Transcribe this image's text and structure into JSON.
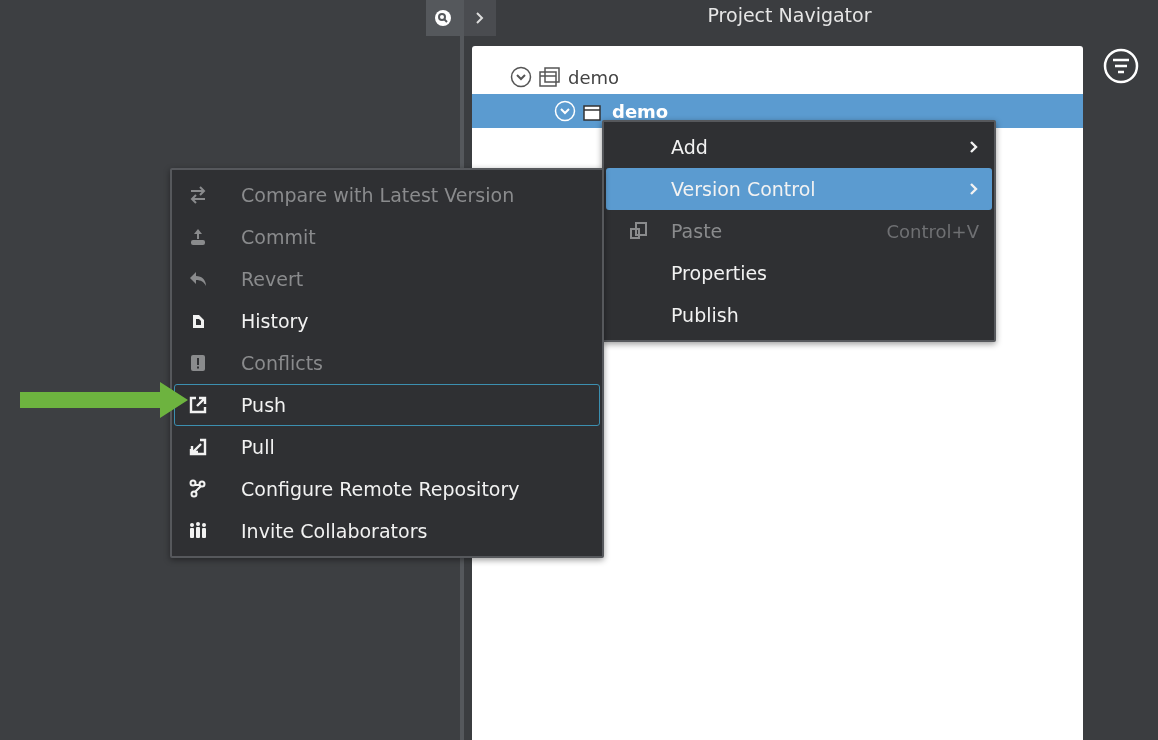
{
  "header": {
    "title": "Project Navigator"
  },
  "tree": [
    {
      "label": "demo",
      "expanded": true,
      "selected": false,
      "children": [
        {
          "label": "demo",
          "expanded": true,
          "selected": true
        }
      ]
    }
  ],
  "context_menu": [
    {
      "label": "Add",
      "kind": "submenu",
      "disabled": false,
      "selected": false
    },
    {
      "label": "Version Control",
      "kind": "submenu",
      "disabled": false,
      "selected": true
    },
    {
      "label": "Paste",
      "kind": "shortcut",
      "shortcut": "Control+V",
      "disabled": true,
      "selected": false
    },
    {
      "label": "Properties",
      "kind": "item",
      "disabled": false,
      "selected": false
    },
    {
      "label": "Publish",
      "kind": "item",
      "disabled": false,
      "selected": false
    }
  ],
  "version_control_menu": [
    {
      "label": "Compare with Latest Version",
      "disabled": true,
      "selected": false
    },
    {
      "label": "Commit",
      "disabled": true,
      "selected": false
    },
    {
      "label": "Revert",
      "disabled": true,
      "selected": false
    },
    {
      "label": "History",
      "disabled": false,
      "selected": false
    },
    {
      "label": "Conflicts",
      "disabled": true,
      "selected": false
    },
    {
      "label": "Push",
      "disabled": false,
      "selected": true
    },
    {
      "label": "Pull",
      "disabled": false,
      "selected": false
    },
    {
      "label": "Configure Remote Repository",
      "disabled": false,
      "selected": false
    },
    {
      "label": "Invite Collaborators",
      "disabled": false,
      "selected": false
    }
  ]
}
